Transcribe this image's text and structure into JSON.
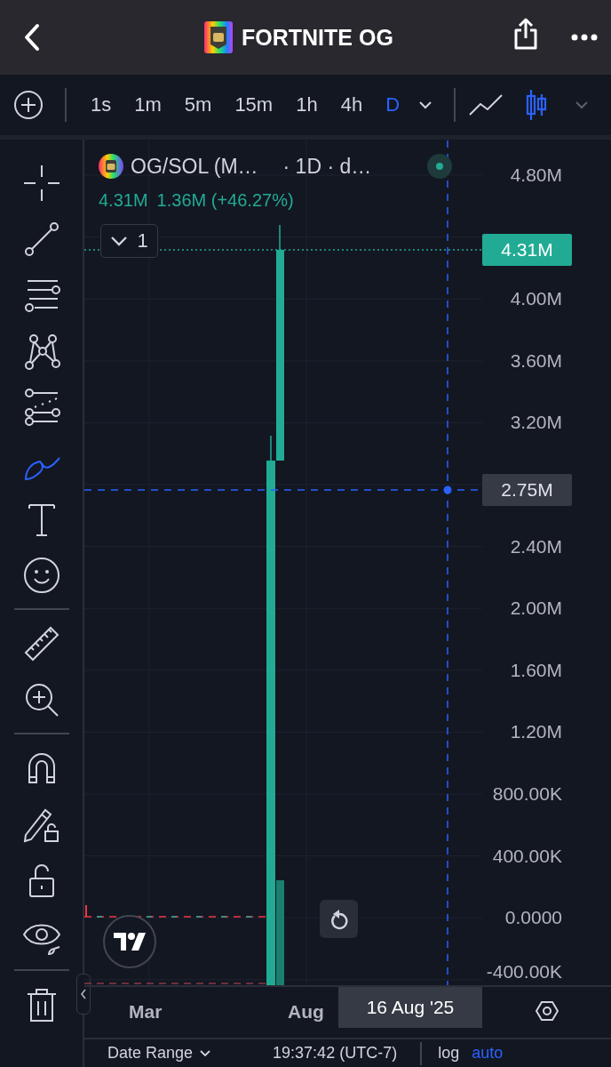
{
  "header": {
    "title": "FORTNITE OG"
  },
  "intervals": [
    {
      "label": "1s",
      "selected": false
    },
    {
      "label": "1m",
      "selected": false
    },
    {
      "label": "5m",
      "selected": false
    },
    {
      "label": "15m",
      "selected": false
    },
    {
      "label": "1h",
      "selected": false
    },
    {
      "label": "4h",
      "selected": false
    },
    {
      "label": "D",
      "selected": true
    }
  ],
  "chart_types": [
    {
      "kind": "line",
      "selected": false
    },
    {
      "kind": "candles",
      "selected": true
    }
  ],
  "tool_groups": [
    [
      {
        "kind": "crosshair",
        "selected": false
      },
      {
        "kind": "trend-line",
        "selected": false
      },
      {
        "kind": "parallel-lines",
        "selected": false
      },
      {
        "kind": "pattern",
        "selected": false
      },
      {
        "kind": "forecast",
        "selected": false
      },
      {
        "kind": "brush",
        "selected": true
      },
      {
        "kind": "text",
        "selected": false
      },
      {
        "kind": "emoji",
        "selected": false
      }
    ],
    [
      {
        "kind": "ruler",
        "selected": false
      },
      {
        "kind": "zoom",
        "selected": false
      }
    ],
    [
      {
        "kind": "magnet",
        "selected": false
      },
      {
        "kind": "lock-drawing",
        "selected": false
      },
      {
        "kind": "lock",
        "selected": false
      },
      {
        "kind": "eye",
        "selected": false
      }
    ],
    [
      {
        "kind": "trash",
        "selected": false
      }
    ]
  ],
  "legend": {
    "symbol": "OG/SOL (M…",
    "details": "· 1D · d…",
    "price": "4.31M",
    "change": "1.36M (+46.27%)"
  },
  "indicators_toggle": {
    "count": "1"
  },
  "price_axis": [
    "4.80M",
    "4.00M",
    "3.60M",
    "3.20M",
    "2.40M",
    "2.00M",
    "1.60M",
    "1.20M",
    "800.00K",
    "400.00K",
    "0.0000",
    "-400.00K"
  ],
  "last_price": "4.31M",
  "crosshair_price": "2.75M",
  "time_axis": [
    "Mar",
    "Aug"
  ],
  "crosshair_date": "16 Aug '25",
  "bottom_bar": {
    "range": "Date Range",
    "time": "19:37:42 (UTC-7)",
    "scale_log": "log",
    "scale_auto": "auto"
  }
}
